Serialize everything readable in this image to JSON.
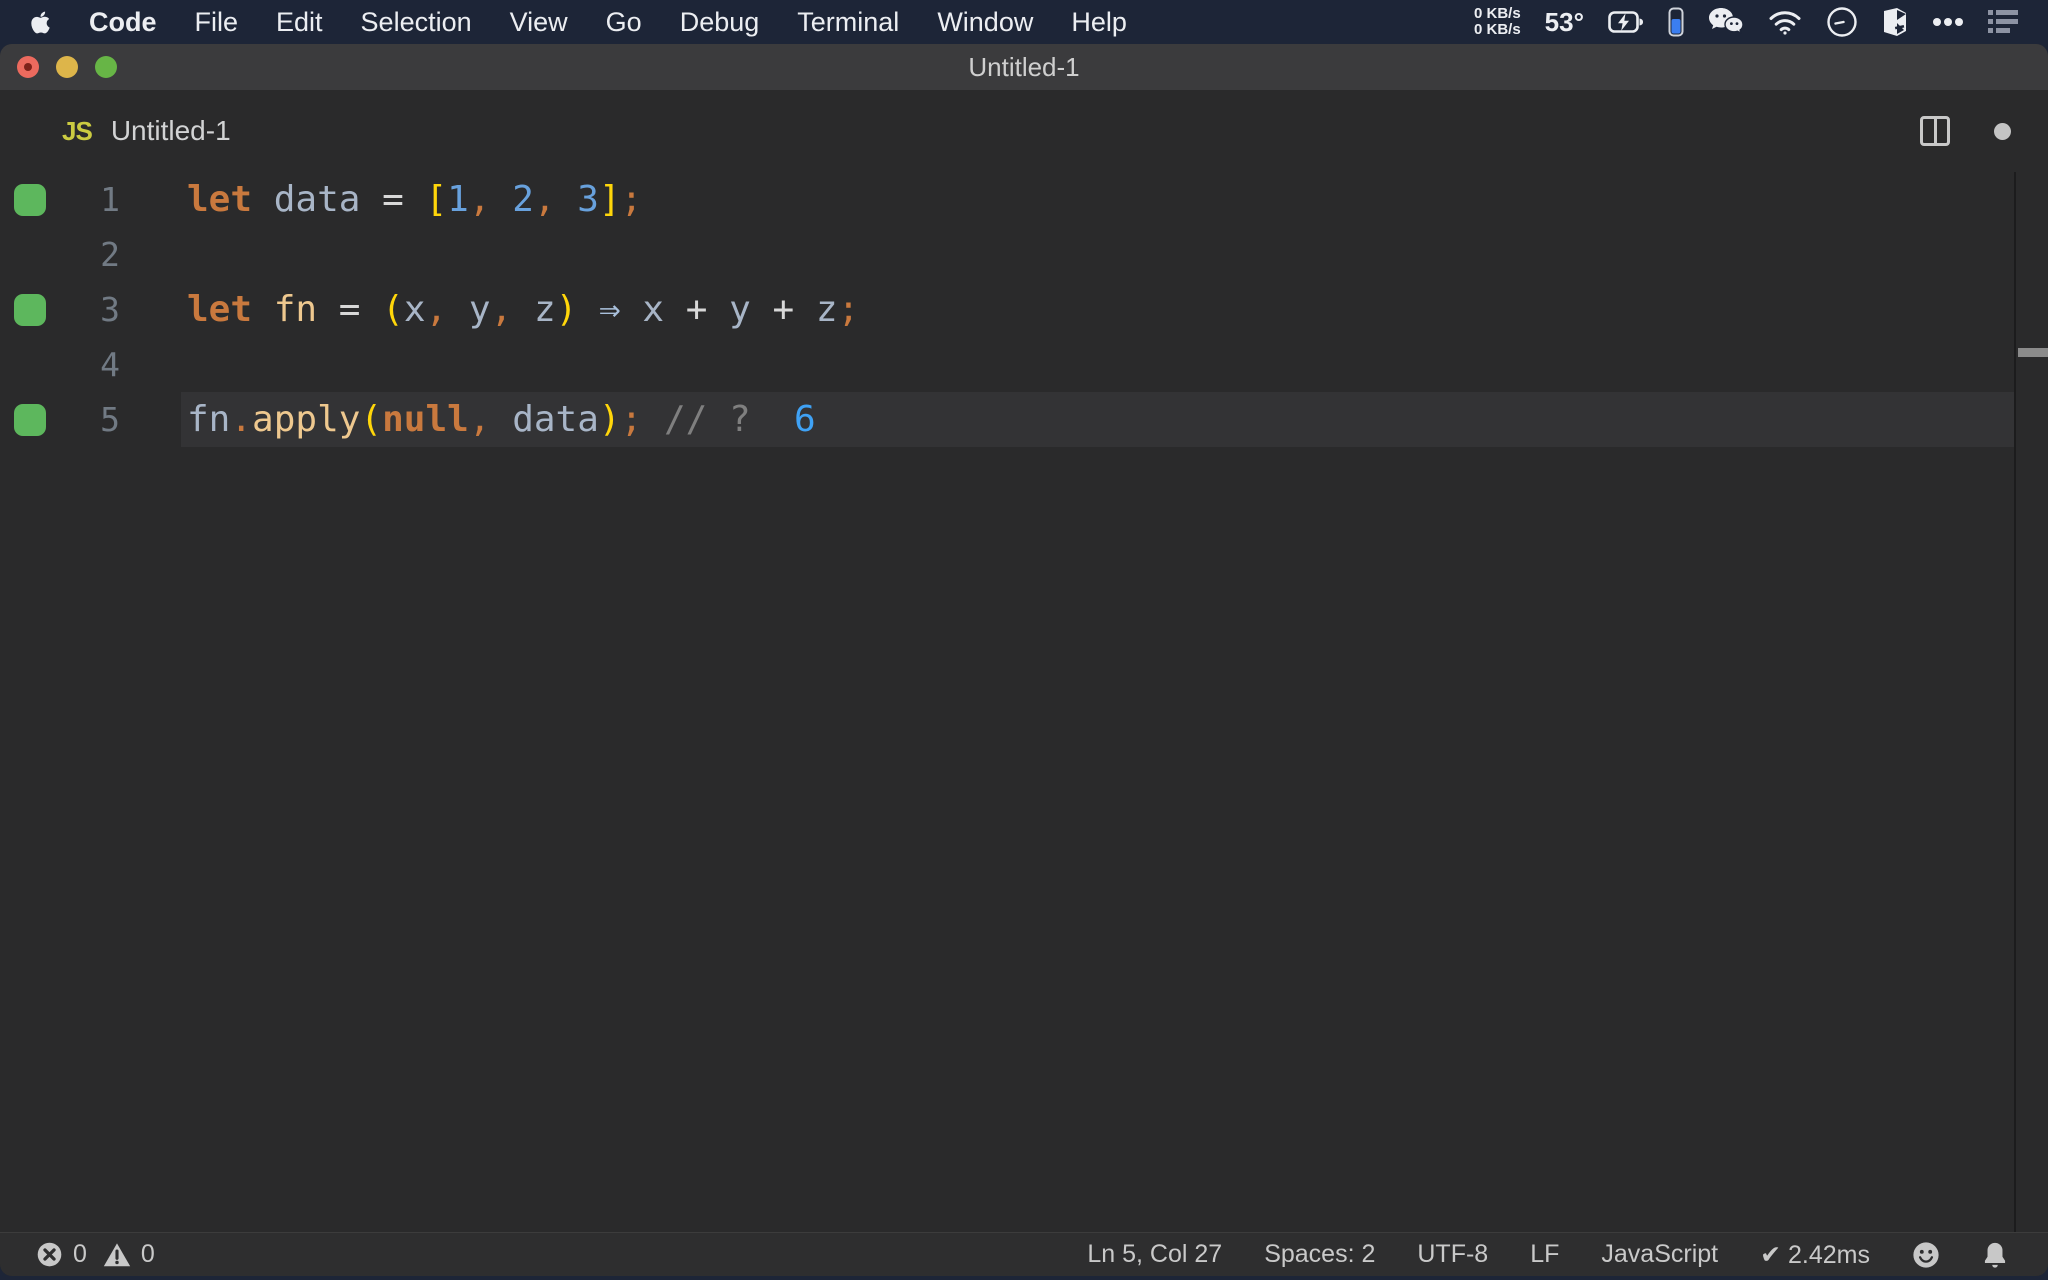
{
  "colors": {
    "navy": "#1d2537",
    "menuFg": "#eceef2",
    "titlebarBg": "#3b3b3d",
    "editorBg": "#2a2a2b",
    "lineHl": "#333335",
    "statusBg": "#2e2e2f",
    "jsIcon": "#cbcb41",
    "marker": "#5db75d",
    "lineNum": "#717a84",
    "kw": "#c9793e",
    "punct": "#c9793e",
    "ident": "#a8b5c7",
    "op": "#d8d8d8",
    "bracket": "#ffd60a",
    "num": "#68a1dd",
    "fname": "#eec88f",
    "comment": "#7f7f7f",
    "result": "#3fa2f5",
    "arrow": "#a9c0dc"
  },
  "menubar": {
    "items": [
      {
        "label": "Code",
        "bold": true
      },
      {
        "label": "File"
      },
      {
        "label": "Edit"
      },
      {
        "label": "Selection"
      },
      {
        "label": "View"
      },
      {
        "label": "Go"
      },
      {
        "label": "Debug"
      },
      {
        "label": "Terminal"
      },
      {
        "label": "Window"
      },
      {
        "label": "Help"
      }
    ],
    "status": {
      "net_up": "0 KB/s",
      "net_down": "0 KB/s",
      "temperature": "53°",
      "icons": [
        "apple-icon",
        "battery-charging-icon",
        "battery-level-icon",
        "wechat-icon",
        "wifi-icon",
        "do-not-disturb-icon",
        "cube-icon",
        "more-icon",
        "list-icon"
      ]
    }
  },
  "window": {
    "title": "Untitled-1"
  },
  "editor": {
    "tab": {
      "icon_label": "JS",
      "label": "Untitled-1",
      "modified": true
    },
    "action_icons": [
      "split-editor-icon",
      "unsaved-dot"
    ],
    "lines": [
      {
        "num": "1",
        "marker": true,
        "current": false,
        "tokens": [
          {
            "t": "let",
            "c": "kw"
          },
          {
            "t": " ",
            "c": "pl"
          },
          {
            "t": "data",
            "c": "id"
          },
          {
            "t": " ",
            "c": "pl"
          },
          {
            "t": "=",
            "c": "op"
          },
          {
            "t": " ",
            "c": "pl"
          },
          {
            "t": "[",
            "c": "br"
          },
          {
            "t": "1",
            "c": "nu"
          },
          {
            "t": ",",
            "c": "pu"
          },
          {
            "t": " ",
            "c": "pl"
          },
          {
            "t": "2",
            "c": "nu"
          },
          {
            "t": ",",
            "c": "pu"
          },
          {
            "t": " ",
            "c": "pl"
          },
          {
            "t": "3",
            "c": "nu"
          },
          {
            "t": "]",
            "c": "br"
          },
          {
            "t": ";",
            "c": "pu"
          }
        ]
      },
      {
        "num": "2",
        "marker": false,
        "current": false,
        "tokens": []
      },
      {
        "num": "3",
        "marker": true,
        "current": false,
        "tokens": [
          {
            "t": "let",
            "c": "kw"
          },
          {
            "t": " ",
            "c": "pl"
          },
          {
            "t": "fn",
            "c": "fn"
          },
          {
            "t": " ",
            "c": "pl"
          },
          {
            "t": "=",
            "c": "op"
          },
          {
            "t": " ",
            "c": "pl"
          },
          {
            "t": "(",
            "c": "br"
          },
          {
            "t": "x",
            "c": "id"
          },
          {
            "t": ",",
            "c": "pu"
          },
          {
            "t": " ",
            "c": "pl"
          },
          {
            "t": "y",
            "c": "id"
          },
          {
            "t": ",",
            "c": "pu"
          },
          {
            "t": " ",
            "c": "pl"
          },
          {
            "t": "z",
            "c": "id"
          },
          {
            "t": ")",
            "c": "br"
          },
          {
            "t": " ",
            "c": "pl"
          },
          {
            "t": "⇒",
            "c": "ar"
          },
          {
            "t": " ",
            "c": "pl"
          },
          {
            "t": "x",
            "c": "id"
          },
          {
            "t": " ",
            "c": "pl"
          },
          {
            "t": "+",
            "c": "op"
          },
          {
            "t": " ",
            "c": "pl"
          },
          {
            "t": "y",
            "c": "id"
          },
          {
            "t": " ",
            "c": "pl"
          },
          {
            "t": "+",
            "c": "op"
          },
          {
            "t": " ",
            "c": "pl"
          },
          {
            "t": "z",
            "c": "id"
          },
          {
            "t": ";",
            "c": "pu"
          }
        ]
      },
      {
        "num": "4",
        "marker": false,
        "current": false,
        "tokens": []
      },
      {
        "num": "5",
        "marker": true,
        "current": true,
        "tokens": [
          {
            "t": "fn",
            "c": "id"
          },
          {
            "t": ".",
            "c": "pu"
          },
          {
            "t": "apply",
            "c": "fn"
          },
          {
            "t": "(",
            "c": "br"
          },
          {
            "t": "null",
            "c": "kw"
          },
          {
            "t": ",",
            "c": "pu"
          },
          {
            "t": " ",
            "c": "pl"
          },
          {
            "t": "data",
            "c": "id"
          },
          {
            "t": ")",
            "c": "br"
          },
          {
            "t": ";",
            "c": "pu"
          },
          {
            "t": " ",
            "c": "pl"
          },
          {
            "t": "// ?",
            "c": "cm"
          },
          {
            "t": "  ",
            "c": "pl"
          },
          {
            "t": "6",
            "c": "rs"
          }
        ]
      }
    ]
  },
  "statusbar": {
    "errors": "0",
    "warnings": "0",
    "items": [
      {
        "name": "cursor-position",
        "label": "Ln 5, Col 27"
      },
      {
        "name": "indentation",
        "label": "Spaces: 2"
      },
      {
        "name": "encoding",
        "label": "UTF-8"
      },
      {
        "name": "eol",
        "label": "LF"
      },
      {
        "name": "language",
        "label": "JavaScript"
      },
      {
        "name": "quokka-time",
        "label": "✔ 2.42ms"
      }
    ],
    "right_icons": [
      "feedback-smiley-icon",
      "notifications-bell-icon"
    ]
  }
}
